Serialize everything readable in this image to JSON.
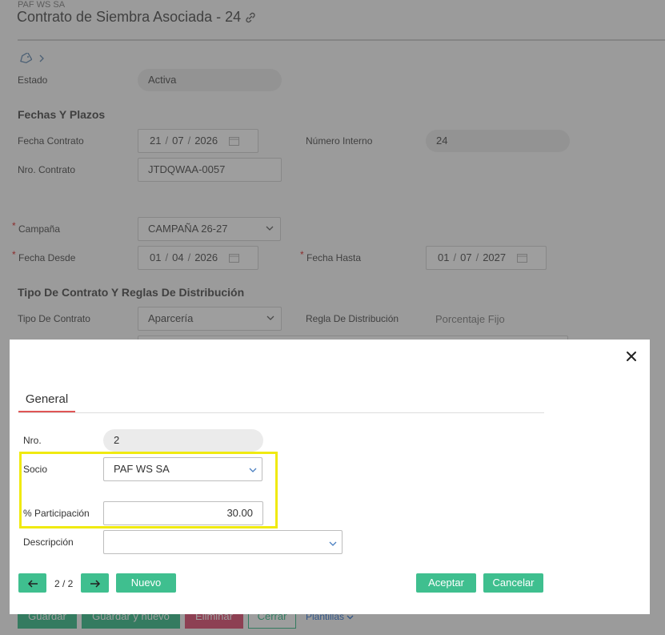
{
  "page": {
    "company": "PAF WS SA",
    "title": "Contrato de Siembra Asociada - 24",
    "estado_label": "Estado",
    "estado_value": "Activa",
    "section_fechas": "Fechas Y Plazos",
    "fecha_contrato_label": "Fecha Contrato",
    "fecha_contrato": {
      "dd": "21",
      "mm": "07",
      "yyyy": "2026"
    },
    "numero_interno_label": "Número Interno",
    "numero_interno_value": "24",
    "nro_contrato_label": "Nro. Contrato",
    "nro_contrato_value": "JTDQWAA-0057",
    "campana_label": "Campaña",
    "campana_value": "CAMPAÑA 26-27",
    "fecha_desde_label": "Fecha Desde",
    "fecha_desde": {
      "dd": "01",
      "mm": "04",
      "yyyy": "2026"
    },
    "fecha_hasta_label": "Fecha Hasta",
    "fecha_hasta": {
      "dd": "01",
      "mm": "07",
      "yyyy": "2027"
    },
    "section_tipo": "Tipo De Contrato Y Reglas De Distribución",
    "tipo_contrato_label": "Tipo De Contrato",
    "tipo_contrato_value": "Aparcería",
    "regla_label": "Regla De Distribución",
    "regla_value": "Porcentaje Fijo",
    "bottom": {
      "guardar": "Guardar",
      "guardar_nuevo": "Guardar y nuevo",
      "eliminar": "Eliminar",
      "cerrar": "Cerrar",
      "plantillas": "Plantillas"
    }
  },
  "modal": {
    "tab_general": "General",
    "nro_label": "Nro.",
    "nro_value": "2",
    "socio_label": "Socio",
    "socio_value": "PAF WS SA",
    "participacion_label": "% Participación",
    "participacion_value": "30.00",
    "descripcion_label": "Descripción",
    "descripcion_value": "",
    "pager": "2 / 2",
    "nuevo_label": "Nuevo",
    "aceptar_label": "Aceptar",
    "cancelar_label": "Cancelar"
  },
  "colors": {
    "accent": "#3fbf8f",
    "tab_underline": "#e05555",
    "highlight": "#f0ea10",
    "danger": "#e05577"
  }
}
